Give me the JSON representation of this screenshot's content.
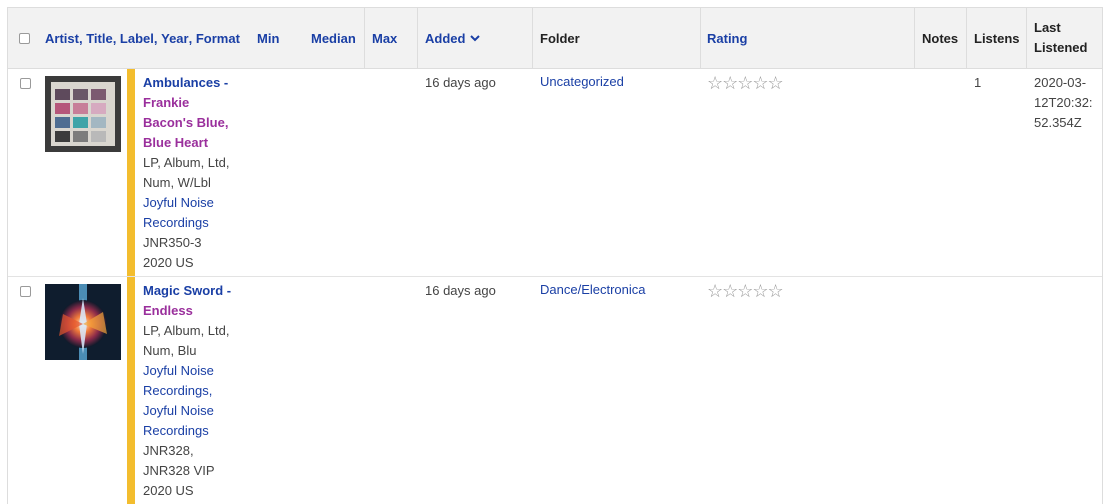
{
  "header": {
    "artist": "Artist",
    "title": "Title",
    "label": "Label",
    "year": "Year",
    "format": "Format",
    "min": "Min",
    "median": "Median",
    "max": "Max",
    "added": "Added",
    "folder": "Folder",
    "rating": "Rating",
    "notes": "Notes",
    "listens": "Listens",
    "last_listened_1": "Last",
    "last_listened_2": "Listened"
  },
  "rows": [
    {
      "artist": "Ambulances",
      "title_1": "Frankie",
      "title_2": "Bacon's Blue,",
      "title_3": "Blue Heart",
      "format_1": "LP, Album, Ltd,",
      "format_2": "Num, W/Lbl",
      "label_1": "Joyful Noise",
      "label_2": "Recordings",
      "catno_1": "JNR350-3",
      "year_country": "2020 US",
      "added": "16 days ago",
      "folder": "Uncategorized",
      "rating": "☆☆☆☆☆",
      "listens": "1",
      "last_1": "2020-03-",
      "last_2": "12T20:32:",
      "last_3": "52.354Z"
    },
    {
      "artist": "Magic Sword",
      "title_1": "Endless",
      "format_1": "LP, Album, Ltd,",
      "format_2": "Num, Blu",
      "label_1": "Joyful Noise",
      "label_2": "Recordings,",
      "label_3": "Joyful Noise",
      "label_4": "Recordings",
      "catno_1": "JNR328,",
      "catno_2": "JNR328 VIP",
      "year_country": "2020 US",
      "added": "16 days ago",
      "folder": "Dance/Electronica",
      "rating": "☆☆☆☆☆"
    }
  ],
  "icons": {
    "sort_desc": "chevron-down-icon",
    "star": "star-outline-icon"
  },
  "colors": {
    "link": "#1a3fa5",
    "title": "#9a2f9c",
    "accent_bar": "#f3bd2e",
    "header_bg": "#f2f2f2"
  }
}
